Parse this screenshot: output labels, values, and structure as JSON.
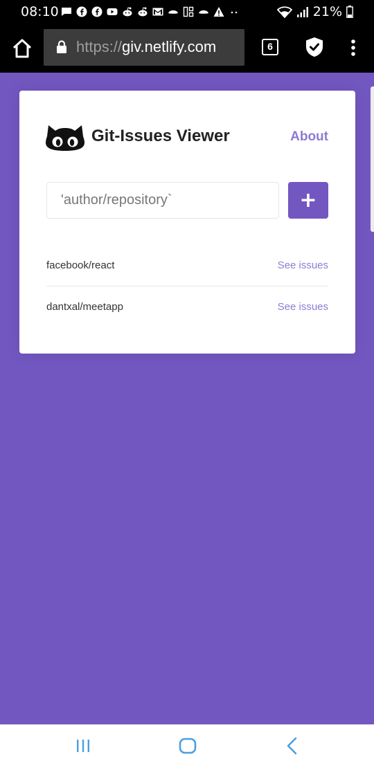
{
  "status_bar": {
    "time": "08:10",
    "battery": "21%",
    "notification_icons": [
      "message-icon",
      "facebook-icon",
      "facebook-icon",
      "youtube-icon",
      "reddit-icon",
      "reddit-icon",
      "gmail-icon",
      "ifood-icon",
      "sim-icon",
      "ifood-icon",
      "warning-icon",
      "more-dots-icon"
    ]
  },
  "browser": {
    "url_scheme": "https://",
    "url_host": "giv.netlify.com",
    "tab_count": "6"
  },
  "app": {
    "title": "Git-Issues Viewer",
    "about_label": "About",
    "input_placeholder": "'author/repository`",
    "add_button_label": "+",
    "repositories": [
      {
        "name": "facebook/react",
        "link_label": "See issues"
      },
      {
        "name": "dantxal/meetapp",
        "link_label": "See issues"
      }
    ]
  },
  "colors": {
    "background": "#7357c1",
    "accent": "#8e7bd2",
    "card": "#ffffff"
  }
}
